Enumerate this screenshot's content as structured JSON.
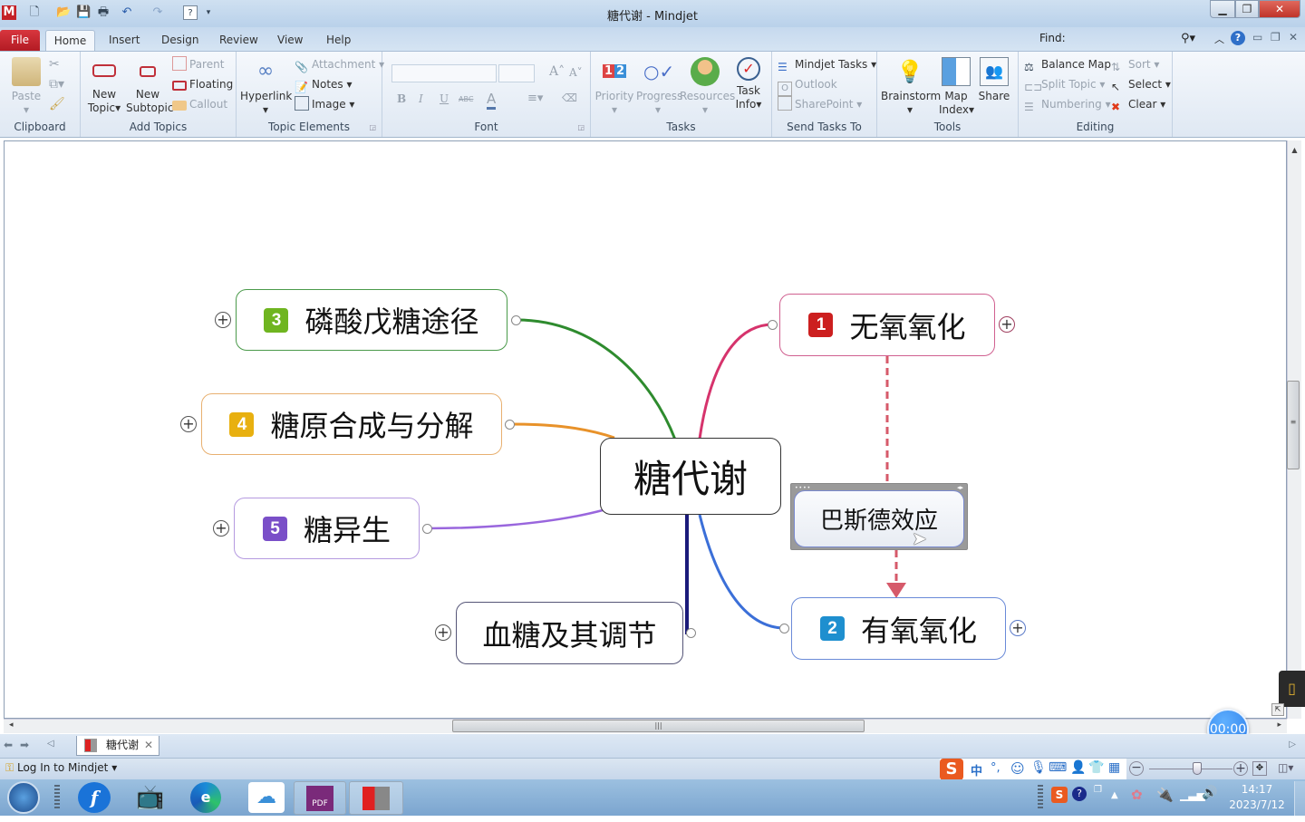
{
  "window": {
    "title": "糖代谢 - Mindjet"
  },
  "quick_access": [
    "app-logo-icon",
    "new-icon",
    "open-icon",
    "save-icon",
    "print-icon",
    "undo-icon",
    "redo-icon",
    "help-icon",
    "customize-icon"
  ],
  "ribbon_tabs": [
    "File",
    "Home",
    "Insert",
    "Design",
    "Review",
    "View",
    "Help"
  ],
  "find": {
    "label": "Find:",
    "value": ""
  },
  "ribbon": {
    "clipboard": {
      "label": "Clipboard",
      "paste": "Paste"
    },
    "add_topics": {
      "label": "Add Topics",
      "new_topic": "New",
      "new_topic2": "Topic",
      "new_subtopic": "New",
      "new_subtopic2": "Subtopic",
      "parent": "Parent",
      "floating": "Floating",
      "callout": "Callout"
    },
    "topic_elements": {
      "label": "Topic Elements",
      "hyperlink": "Hyperlink",
      "attachment": "Attachment",
      "notes": "Notes",
      "image": "Image"
    },
    "font": {
      "label": "Font",
      "bold": "B",
      "italic": "I",
      "underline": "U",
      "strike": "ABC"
    },
    "tasks": {
      "label": "Tasks",
      "priority": "Priority",
      "progress": "Progress",
      "resources": "Resources",
      "task_info": "Task",
      "task_info2": "Info"
    },
    "send_tasks": {
      "label": "Send Tasks To",
      "mindjet_tasks": "Mindjet Tasks",
      "outlook": "Outlook",
      "sharepoint": "SharePoint"
    },
    "tools": {
      "label": "Tools",
      "brainstorm": "Brainstorm",
      "map_index": "Map",
      "map_index2": "Index",
      "share": "Share"
    },
    "editing": {
      "label": "Editing",
      "balance_map": "Balance Map",
      "split_topic": "Split Topic",
      "numbering": "Numbering",
      "sort": "Sort",
      "select": "Select",
      "clear": "Clear"
    }
  },
  "map": {
    "central": "糖代谢",
    "topics": [
      {
        "num": "1",
        "text": "无氧氧化",
        "color": "#d6336c",
        "badge": "#cc1f1f"
      },
      {
        "num": "2",
        "text": "有氧氧化",
        "color": "#3b6fd8",
        "badge": "#1e8fcf"
      },
      {
        "num": "3",
        "text": "磷酸戊糖途径",
        "color": "#2e8b2e",
        "badge": "#6fb520"
      },
      {
        "num": "4",
        "text": "糖原合成与分解",
        "color": "#e8922a",
        "badge": "#e8b010"
      },
      {
        "num": "5",
        "text": "糖异生",
        "color": "#9966dd",
        "badge": "#7a4fc8"
      },
      {
        "num": "",
        "text": "血糖及其调节",
        "color": "#1a1a7a",
        "badge": ""
      }
    ],
    "floating": "巴斯德效应"
  },
  "doc_tab": {
    "title": "糖代谢"
  },
  "status": {
    "login": "Log In to Mindjet"
  },
  "timer": "00:00",
  "clock": {
    "time": "14:17",
    "date": "2023/7/12"
  },
  "ime": {
    "mode": "中"
  }
}
